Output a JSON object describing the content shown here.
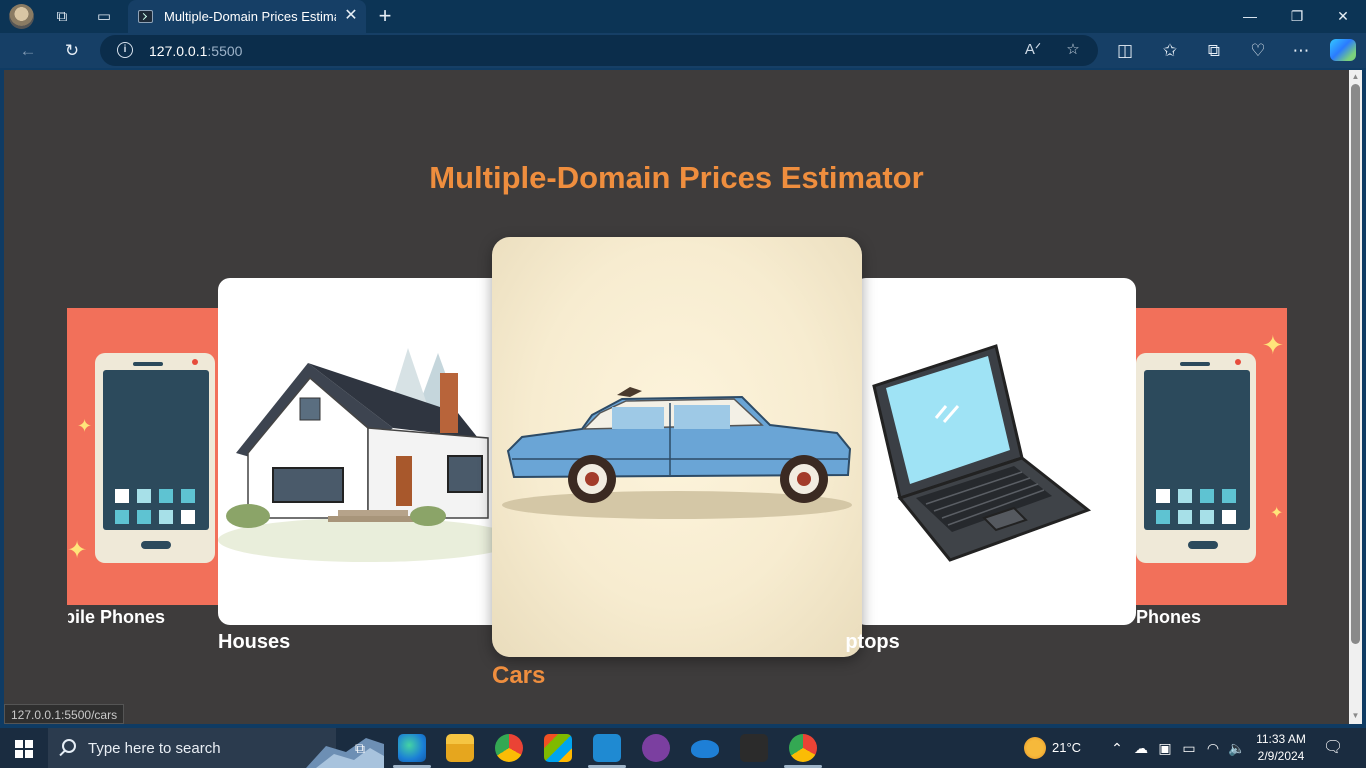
{
  "browser": {
    "tab_title": "Multiple-Domain Prices Estimator",
    "tab_close": "✕",
    "new_tab": "+",
    "url_host": "127.0.0.1",
    "url_port": ":5500",
    "window_controls": {
      "minimize": "—",
      "maximize": "❐",
      "close": "✕"
    }
  },
  "page": {
    "title": "Multiple-Domain Prices Estimator",
    "cards": {
      "phones_left": "Mobile Phones",
      "houses": "Houses",
      "cars": "Cars",
      "laptops": "Laptops",
      "phones_right": "Mobile Phones"
    },
    "status_url": "127.0.0.1:5500/cars",
    "accent_color": "#ef8e3e",
    "background_color": "#3e3c3c"
  },
  "taskbar": {
    "search_placeholder": "Type here to search",
    "weather_temp": "21°C",
    "time": "11:33 AM",
    "date": "2/9/2024"
  }
}
